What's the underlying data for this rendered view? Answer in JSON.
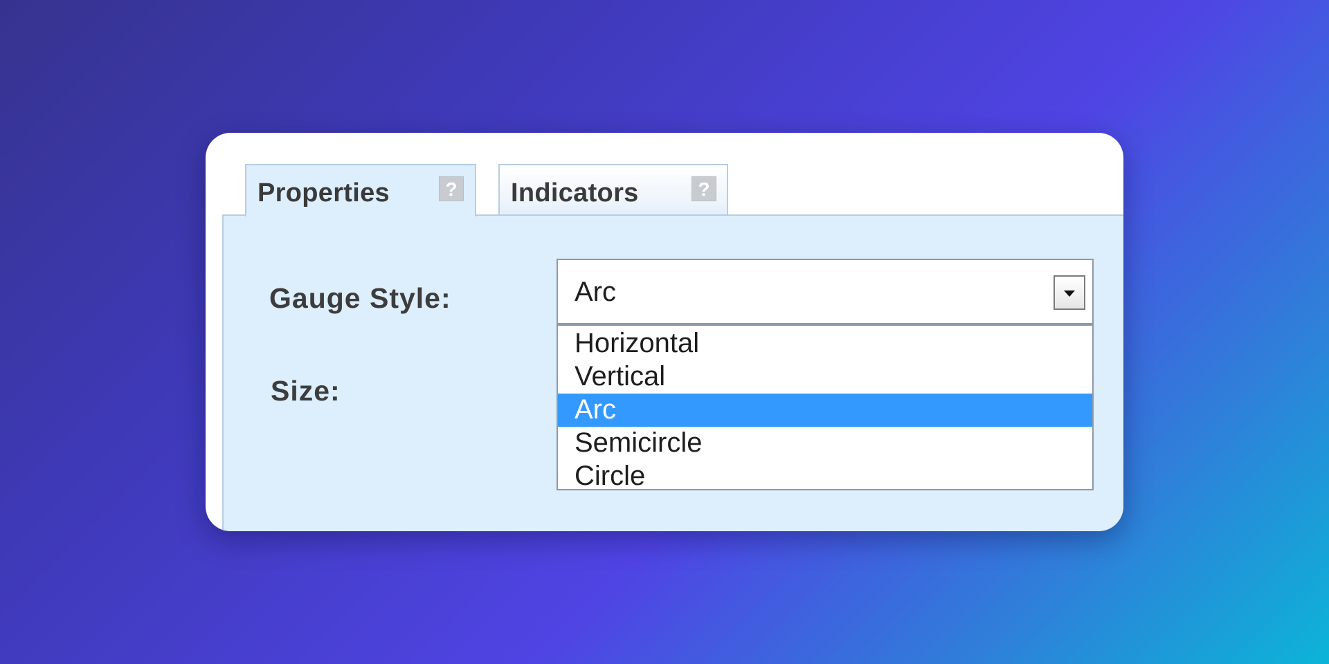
{
  "tabs": [
    {
      "label": "Properties",
      "help": "?",
      "active": true
    },
    {
      "label": "Indicators",
      "help": "?",
      "active": false
    }
  ],
  "form": {
    "gauge_style_label": "Gauge Style:",
    "size_label": "Size:"
  },
  "gauge_style_select": {
    "value": "Arc",
    "options": [
      "Horizontal",
      "Vertical",
      "Arc",
      "Semicircle",
      "Circle"
    ],
    "selected_index": 2
  },
  "colors": {
    "panel_background": "#ddeefd",
    "selected_option": "#3399ff",
    "tab_border": "#b7cde0"
  },
  "icons": {
    "help": "help-question-icon",
    "dropdown": "chevron-down-icon"
  }
}
